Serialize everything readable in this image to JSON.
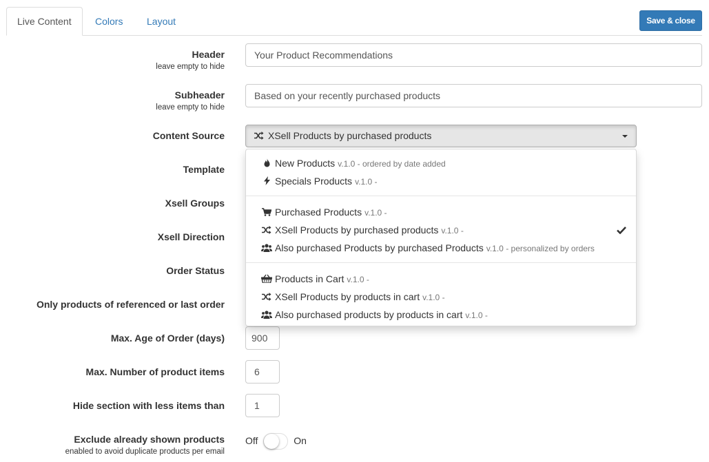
{
  "tabs": [
    {
      "label": "Live Content",
      "active": true
    },
    {
      "label": "Colors",
      "active": false
    },
    {
      "label": "Layout",
      "active": false
    }
  ],
  "save_button": "Save & close",
  "colors": {
    "primary": "#337ab7",
    "link": "#337ab7",
    "muted": "#777777",
    "border": "#cccccc"
  },
  "form": {
    "header": {
      "label": "Header",
      "help": "leave empty to hide",
      "value": "Your Product Recommendations"
    },
    "subheader": {
      "label": "Subheader",
      "help": "leave empty to hide",
      "value": "Based on your recently purchased products"
    },
    "content_source": {
      "label": "Content Source",
      "selected": "XSell Products by purchased products",
      "selected_icon": "random-icon"
    },
    "template": {
      "label": "Template"
    },
    "xsell_groups": {
      "label": "Xsell Groups"
    },
    "xsell_direction": {
      "label": "Xsell Direction"
    },
    "order_status": {
      "label": "Order Status"
    },
    "only_referenced": {
      "label": "Only products of referenced or last order"
    },
    "max_age": {
      "label": "Max. Age of Order (days)",
      "value": "900"
    },
    "max_items": {
      "label": "Max. Number of product items",
      "value": "6"
    },
    "hide_less": {
      "label": "Hide section with less items than",
      "value": "1"
    },
    "exclude_shown": {
      "label": "Exclude already shown products",
      "help": "enabled to avoid duplicate products per email",
      "off_label": "Off",
      "on_label": "On",
      "checked": false
    }
  },
  "dropdown": {
    "groups": [
      [
        {
          "icon": "fire-icon",
          "name": "New Products",
          "meta": "v.1.0 - ordered by date added",
          "selected": false
        },
        {
          "icon": "flash-icon",
          "name": "Specials Products",
          "meta": "v.1.0 -",
          "selected": false
        }
      ],
      [
        {
          "icon": "shopping-cart-icon",
          "name": "Purchased Products",
          "meta": "v.1.0 -",
          "selected": false
        },
        {
          "icon": "random-icon",
          "name": "XSell Products by purchased products",
          "meta": "v.1.0 -",
          "selected": true
        },
        {
          "icon": "users-icon",
          "name": "Also purchased Products by purchased Products",
          "meta": "v.1.0 - personalized by orders",
          "selected": false
        }
      ],
      [
        {
          "icon": "basket-icon",
          "name": "Products in Cart",
          "meta": "v.1.0 -",
          "selected": false
        },
        {
          "icon": "random-icon",
          "name": "XSell Products by products in cart",
          "meta": "v.1.0 -",
          "selected": false
        },
        {
          "icon": "users-icon",
          "name": "Also purchased products by products in cart",
          "meta": "v.1.0 -",
          "selected": false
        }
      ]
    ]
  }
}
